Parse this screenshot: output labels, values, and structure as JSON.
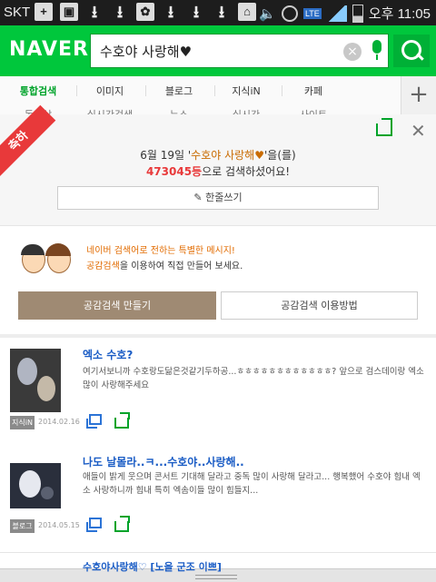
{
  "status_bar": {
    "carrier": "SKT",
    "time": "오후 11:05",
    "lte": "LTE"
  },
  "header": {
    "logo": "NAVER",
    "query": "수호야 사랑해♥"
  },
  "tabs": {
    "row1": [
      "통합검색",
      "이미지",
      "블로그",
      "지식iN",
      "카페"
    ],
    "row2": [
      "동영상",
      "실시간검색",
      "뉴스",
      "실시간",
      "사이트"
    ],
    "active": "통합검색"
  },
  "congrats": {
    "badge": "축하",
    "line1_prefix": "6월 19일 '",
    "line1_query": "수호야 사랑해♥",
    "line1_suffix": "'을(를)",
    "rank": "473045등",
    "line2_suffix": "으로 검색하셨어요!",
    "write_button": "한줄쓰기"
  },
  "promo": {
    "line1": "네이버 검색어로 전하는 특별한 메시지!",
    "line2_highlight": "공감검색",
    "line2_rest": "을 이용하여 직접 만들어 보세요.",
    "make_button": "공감검색 만들기",
    "howto_button": "공감검색 이용방법"
  },
  "results": [
    {
      "title": "엑소 수호?",
      "desc": "여기서보니까 수호랑도닮은것같기두하공...ㅎㅎㅎㅎㅎㅎㅎㅎㅎㅎㅎㅎ? 앞으로 검스데이랑 엑소 많이 사랑해주세요",
      "source": "지식iN",
      "date": "2014.02.16"
    },
    {
      "title": "나도 날몰라..ㅋ...수호야..사랑해..",
      "desc": "애들이 밝게 웃으며 콘서트 기대해 달라고 중독 많이 사랑해 달라고... 행복했어 수호야 힘내 엑소 사랑하니까 힘내 특히 엑솜이들 많이 힘들지...",
      "source": "블로그",
      "date": "2014.05.15"
    }
  ],
  "next_result_title": "수호야사랑해♡ [노을 군조 이쁘]"
}
